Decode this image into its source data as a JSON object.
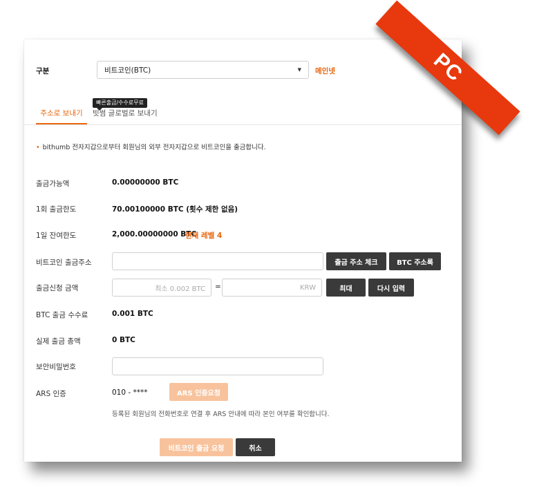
{
  "ribbon": {
    "text": "PC"
  },
  "category": {
    "label": "구분",
    "selected": "비트코인(BTC)",
    "network": "메인넷"
  },
  "tabs": [
    {
      "label": "주소로 보내기",
      "active": true
    },
    {
      "label": "빗썸 글로벌로 보내기",
      "badge": "빠른출금/수수료무료"
    }
  ],
  "notice": "bithumb 전자지갑으로부터 회원님의 외부 전자지갑으로 비트코인을 출금합니다.",
  "rows": {
    "available": {
      "label": "출금가능액",
      "value": "0.00000000 BTC"
    },
    "single_limit": {
      "label": "1회 출금한도",
      "value": "70.00100000 BTC (횟수 제한 없음)"
    },
    "daily_limit": {
      "label": "1일 잔여한도",
      "value": "2,000.00000000 BTC",
      "level": "현재 레벨 4"
    },
    "address": {
      "label": "비트코인 출금주소",
      "check_button": "출금 주소 체크",
      "book_button": "BTC 주소록"
    },
    "amount": {
      "label": "출금신청 금액",
      "btc_placeholder": "최소 0.002 BTC",
      "equals": "=",
      "krw_placeholder": "KRW",
      "max_button": "최대",
      "reset_button": "다시 입력"
    },
    "fee": {
      "label": "BTC 출금 수수료",
      "value": "0.001 BTC"
    },
    "total": {
      "label": "실제 출금 총액",
      "value": "0 BTC"
    },
    "security_pw": {
      "label": "보안비밀번호"
    },
    "ars": {
      "label": "ARS 인증",
      "phone": "010 - ****",
      "button": "ARS 인증요청",
      "note": "등록된 회원님의 전화번호로 연결 후 ARS 안내에 따라 본인 여부를 확인합니다."
    }
  },
  "actions": {
    "submit": "비트코인 출금 요청",
    "cancel": "취소"
  },
  "colors": {
    "accent": "#e8650d",
    "ribbon": "#e8380d",
    "dark_button": "#3a3a3a",
    "disabled_button": "#f8c39c"
  }
}
